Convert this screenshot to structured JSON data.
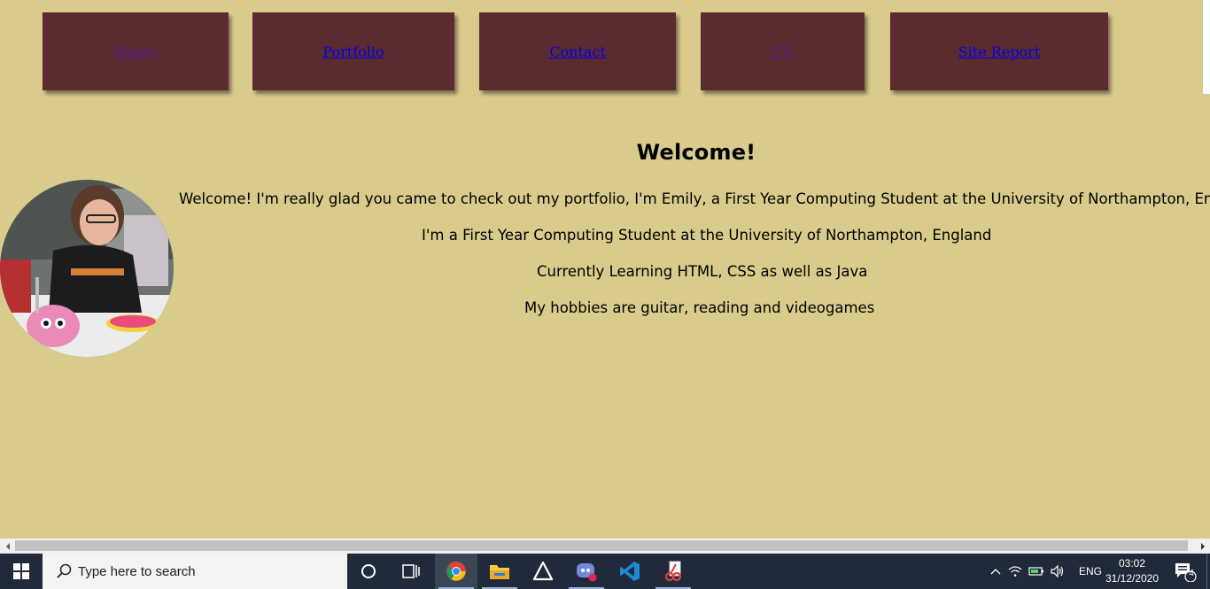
{
  "nav": {
    "items": [
      {
        "label": "Home"
      },
      {
        "label": "Portfolio"
      },
      {
        "label": "Contact"
      },
      {
        "label": "CV"
      },
      {
        "label": "Site Report"
      }
    ]
  },
  "main": {
    "title": "Welcome!",
    "paragraphs": [
      "Welcome! I'm really glad you came to check out my portfolio, I'm Emily, a First Year Computing Student at the University of Northampton, England",
      "I'm a First Year Computing Student at the University of Northampton, England",
      "Currently Learning HTML, CSS as well as Java",
      "My hobbies are guitar, reading and videogames"
    ],
    "avatar_icon": "profile-photo"
  },
  "colors": {
    "background": "#d9cb8c",
    "nav_button": "#5b2b2f",
    "link": "#0000ee",
    "visited_link": "#551a8b",
    "taskbar": "#202a3a"
  },
  "taskbar": {
    "search_placeholder": "Type here to search",
    "apps": [
      "cortana-icon",
      "task-view-icon",
      "chrome-icon",
      "file-explorer-icon",
      "unity-icon",
      "discord-icon",
      "vscode-icon",
      "snip-icon"
    ],
    "tray": {
      "language": "ENG",
      "time": "03:02",
      "date": "31/12/2020",
      "notification_count": "4"
    }
  }
}
